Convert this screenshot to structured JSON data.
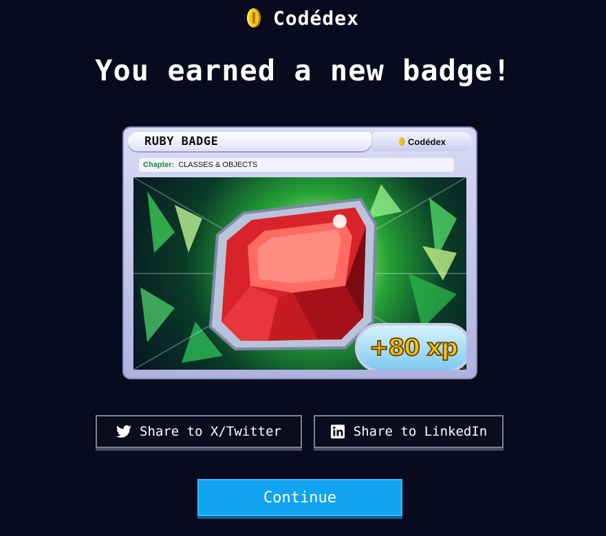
{
  "brand": {
    "name": "Codédex",
    "icon": "coin-icon"
  },
  "heading": "You earned a new badge!",
  "badge_card": {
    "title": "RUBY BADGE",
    "brand": "Codédex",
    "chapter_label": "Chapter:",
    "chapter_value": "CLASSES & OBJECTS",
    "artwork": "ruby-gem-image",
    "xp": "+80 xp"
  },
  "actions": {
    "share_twitter_label": "Share to X/Twitter",
    "share_twitter_icon": "twitter-icon",
    "share_linkedin_label": "Share to LinkedIn",
    "share_linkedin_icon": "linkedin-icon",
    "continue_label": "Continue"
  },
  "colors": {
    "background": "#080b1e",
    "continue_button": "#12a4f0",
    "coin": "#f5c518",
    "xp_text": "#f7c21b",
    "chapter_label": "#1a8a3a"
  }
}
